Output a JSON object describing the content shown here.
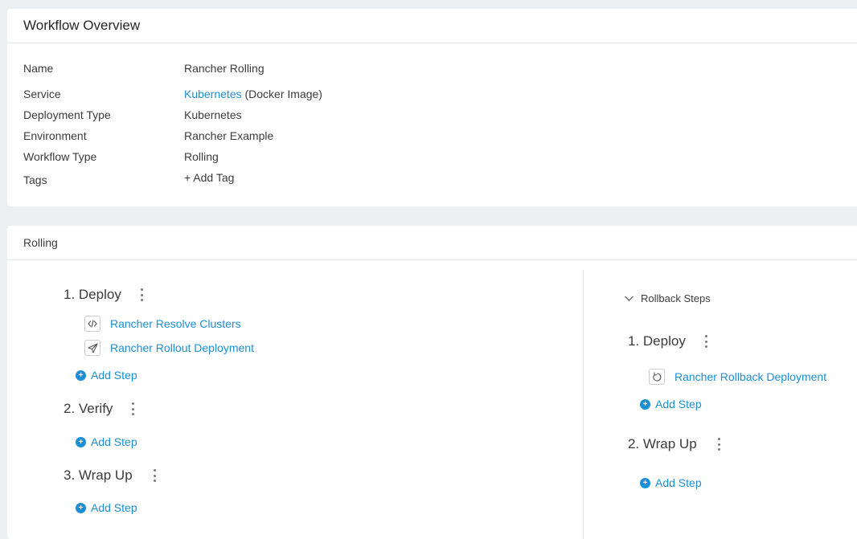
{
  "overview": {
    "title": "Workflow Overview",
    "rows": {
      "name": {
        "label": "Name",
        "value": "Rancher Rolling"
      },
      "service": {
        "label": "Service",
        "link": "Kubernetes",
        "suffix": " (Docker Image)"
      },
      "deployment_type": {
        "label": "Deployment Type",
        "value": "Kubernetes"
      },
      "environment": {
        "label": "Environment",
        "link": "Rancher Example"
      },
      "workflow_type": {
        "label": "Workflow Type",
        "value": "Rolling"
      },
      "tags": {
        "label": "Tags",
        "link": "+ Add Tag"
      }
    }
  },
  "rolling": {
    "title": "Rolling",
    "phases": [
      {
        "title": "1. Deploy",
        "steps": [
          "Rancher Resolve Clusters",
          "Rancher Rollout Deployment"
        ],
        "add_step": "Add Step"
      },
      {
        "title": "2. Verify",
        "add_step": "Add Step"
      },
      {
        "title": "3. Wrap Up",
        "add_step": "Add Step"
      }
    ],
    "rollback": {
      "toggle_label": "Rollback Steps",
      "phases": [
        {
          "title": "1. Deploy",
          "steps": [
            "Rancher Rollback Deployment"
          ],
          "add_step": "Add Step"
        },
        {
          "title": "2. Wrap Up",
          "add_step": "Add Step"
        }
      ]
    }
  },
  "icons": {
    "resolve": "code-icon",
    "rollout": "send-icon",
    "rollback": "rollback-icon",
    "toggle": "chevron-down-icon",
    "plus": "plus-icon",
    "kebab": "kebab-menu-icon"
  },
  "colors": {
    "link": "#1a8fd6",
    "background": "#eceff2"
  }
}
